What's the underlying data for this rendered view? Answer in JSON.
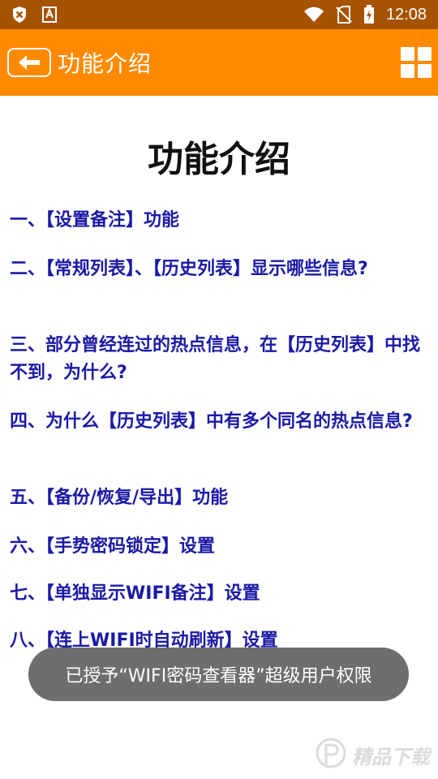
{
  "status_bar": {
    "time": "12:08",
    "left_icons": [
      "notification-close-icon",
      "font-app-icon"
    ],
    "right_icons": [
      "wifi-icon",
      "no-sim-icon",
      "battery-charging-icon"
    ]
  },
  "app_bar": {
    "title": "功能介绍",
    "back_icon": "arrow-left-icon",
    "menu_icon": "grid-icon",
    "background": "#ff8a00"
  },
  "page": {
    "heading": "功能介绍",
    "items": [
      "一、【设置备注】功能",
      "二、【常规列表】、【历史列表】显示哪些信息?",
      "三、部分曾经连过的热点信息，在【历史列表】中找不到，为什么?",
      "四、为什么【历史列表】中有多个同名的热点信息?",
      "五、【备份/恢复/导出】功能",
      "六、【手势密码锁定】设置",
      "七、【单独显示WIFI备注】设置",
      "八、【连上WIFI时自动刷新】设置"
    ],
    "link_color": "#1a1aa6"
  },
  "toast": {
    "message": "已授予“WIFI密码查看器”超级用户权限"
  },
  "watermark": {
    "text": "精品下载"
  }
}
